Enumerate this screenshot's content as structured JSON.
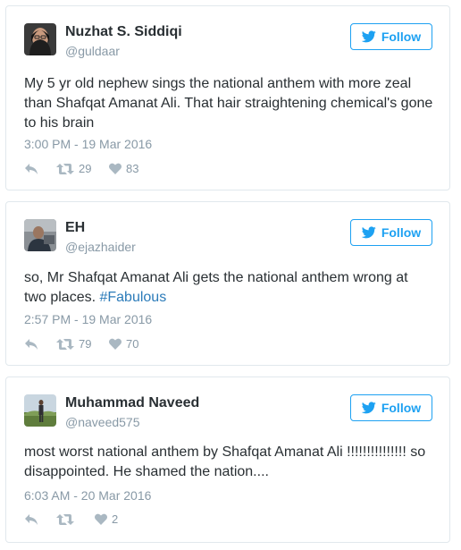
{
  "tweets": [
    {
      "name": "Nuzhat S. Siddiqi",
      "handle": "@guldaar",
      "follow_label": "Follow",
      "text": "My 5 yr old nephew sings the national anthem with more zeal than Shafqat Amanat Ali. That hair straightening chemical's gone to his brain",
      "hashtag": "",
      "timestamp": "3:00 PM - 19 Mar 2016",
      "retweets": "29",
      "likes": "83"
    },
    {
      "name": "EH",
      "handle": "@ejazhaider",
      "follow_label": "Follow",
      "text": "so, Mr Shafqat Amanat Ali gets the national anthem wrong at two places. ",
      "hashtag": "#Fabulous",
      "timestamp": "2:57 PM - 19 Mar 2016",
      "retweets": "79",
      "likes": "70"
    },
    {
      "name": "Muhammad Naveed",
      "handle": "@naveed575",
      "follow_label": "Follow",
      "text": "most worst national anthem by Shafqat Amanat Ali !!!!!!!!!!!!!!! so disappointed. He shamed the nation....",
      "hashtag": "",
      "timestamp": "6:03 AM - 20 Mar 2016",
      "retweets": "",
      "likes": "2"
    }
  ],
  "colors": {
    "accent": "#1da1f2",
    "hashtag": "#2b7bb9",
    "muted": "#8899a6",
    "border": "#e1e8ed"
  },
  "icons": [
    "twitter-bird-icon",
    "reply-icon",
    "retweet-icon",
    "heart-icon"
  ]
}
